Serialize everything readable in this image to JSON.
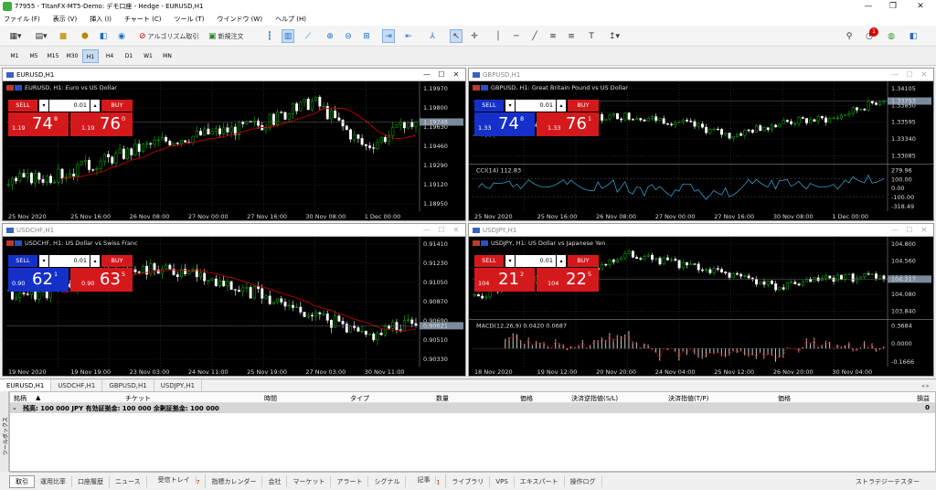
{
  "window": {
    "title": "77955 - TitanFX-MT5-Demo: デモ口座 - Hedge - EURUSD,H1",
    "min": "—",
    "max": "❐",
    "close": "✕"
  },
  "menu": [
    "ファイル (F)",
    "表示 (V)",
    "挿入 (I)",
    "チャート (C)",
    "ツール (T)",
    "ウインドウ (W)",
    "ヘルプ (H)"
  ],
  "toolbar": {
    "algo_label": "アルゴリズム取引",
    "neworder_label": "新規注文",
    "notify_badge": "1"
  },
  "timeframes": [
    "M1",
    "M5",
    "M15",
    "M30",
    "H1",
    "H4",
    "D1",
    "W1",
    "MN"
  ],
  "timeframe_active": "H1",
  "colors": {
    "bull": "#00c000",
    "bear": "#ffffff",
    "ma": "#c00000",
    "sell": "#d4191c",
    "sell_blue": "#1530c8",
    "buy": "#d4191c",
    "grid": "#3a3a3a",
    "bg": "#000000"
  },
  "charts": [
    {
      "id": "EURUSD",
      "tab_title": "EURUSD,H1",
      "caption": "EURUSD, H1:  Euro vs US Dollar",
      "active": true,
      "sell_label": "SELL",
      "buy_label": "BUY",
      "lot": "0.01",
      "sell_prefix": "1.19",
      "sell_big": "74",
      "sell_sup": "8",
      "buy_prefix": "1.19",
      "buy_big": "76",
      "buy_sup": "0",
      "sell_blue": false,
      "price_labels": [
        "1.19970",
        "1.19800",
        "1.19630",
        "1.19460",
        "1.19290",
        "1.19120",
        "1.18950"
      ],
      "current_price": "1.19748",
      "time_labels": [
        "25 Nov 2020",
        "25 Nov 16:00",
        "26 Nov 08:00",
        "27 Nov 00:00",
        "27 Nov 16:00",
        "30 Nov 08:00",
        "1 Dec 00:00"
      ],
      "seed": 3,
      "trend": [
        0.2,
        0.25,
        0.4,
        0.55,
        0.62,
        0.7,
        0.9,
        0.5,
        0.72
      ],
      "indicator": null
    },
    {
      "id": "GBPUSD",
      "tab_title": "GBPUSD,H1",
      "caption": "GBPUSD, H1:  Great Britain Pound vs US Dollar",
      "active": false,
      "sell_label": "SELL",
      "buy_label": "BUY",
      "lot": "0.01",
      "sell_prefix": "1.33",
      "sell_big": "74",
      "sell_sup": "8",
      "buy_prefix": "1.33",
      "buy_big": "76",
      "buy_sup": "1",
      "sell_blue": true,
      "price_labels": [
        "1.34105",
        "1.33850",
        "1.33595",
        "1.33340",
        "1.33085"
      ],
      "current_price": "1.33753",
      "time_labels": [
        "25 Nov 2020",
        "25 Nov 16:00",
        "26 Nov 08:00",
        "27 Nov 00:00",
        "27 Nov 16:00",
        "30 Nov 08:00",
        "1 Dec 00:00"
      ],
      "seed": 7,
      "trend": [
        0.3,
        0.45,
        0.55,
        0.6,
        0.5,
        0.3,
        0.5,
        0.55,
        0.85
      ],
      "indicator": {
        "type": "cci",
        "caption": "CCI(14) 112.83",
        "labels": [
          "279.96",
          "100.00",
          "0.00",
          "-100.00",
          "-318.49"
        ]
      }
    },
    {
      "id": "USDCHF",
      "tab_title": "USDCHF,H1",
      "caption": "USDCHF, H1:  US Dollar vs Swiss Franc",
      "active": false,
      "sell_label": "SELL",
      "buy_label": "BUY",
      "lot": "0.01",
      "sell_prefix": "0.90",
      "sell_big": "62",
      "sell_sup": "1",
      "buy_prefix": "0.90",
      "buy_big": "63",
      "buy_sup": "5",
      "sell_blue": true,
      "price_labels": [
        "0.91410",
        "0.91230",
        "0.91050",
        "0.90870",
        "0.90690",
        "0.90510",
        "0.90330"
      ],
      "current_price": "0.90621",
      "time_labels": [
        "19 Nov 2020",
        "19 Nov 19:00",
        "23 Nov 03:00",
        "24 Nov 11:00",
        "25 Nov 19:00",
        "27 Nov 03:00",
        "30 Nov 11:00"
      ],
      "seed": 11,
      "trend": [
        0.55,
        0.6,
        0.75,
        0.8,
        0.7,
        0.55,
        0.4,
        0.2,
        0.35
      ],
      "indicator": null
    },
    {
      "id": "USDJPY",
      "tab_title": "USDJPY,H1",
      "caption": "USDJPY, H1:  US Dollar vs Japanese Yen",
      "active": false,
      "sell_label": "SELL",
      "buy_label": "BUY",
      "lot": "0.01",
      "sell_prefix": "104",
      "sell_big": "21",
      "sell_sup": "2",
      "buy_prefix": "104",
      "buy_big": "22",
      "buy_sup": "5",
      "sell_blue": false,
      "price_labels": [
        "104.800",
        "104.560",
        "104.320",
        "104.080",
        "103.840"
      ],
      "current_price": "104.217",
      "time_labels": [
        "18 Nov 2020",
        "19 Nov 12:00",
        "20 Nov 20:00",
        "24 Nov 04:00",
        "25 Nov 12:00",
        "26 Nov 20:00",
        "30 Nov 04:00"
      ],
      "seed": 5,
      "trend": [
        0.2,
        0.45,
        0.55,
        0.85,
        0.7,
        0.55,
        0.35,
        0.5,
        0.5
      ],
      "indicator": {
        "type": "macd",
        "caption": "MACD(12,26,9) 0.0420 0.0687",
        "labels": [
          "0.3684",
          "0.0000",
          "-0.1666"
        ]
      }
    }
  ],
  "bottom_tabs": [
    "EURUSD,H1",
    "USDCHF,H1",
    "GBPUSD,H1",
    "USDJPY,H1"
  ],
  "bottom_tab_active": "EURUSD,H1",
  "terminal": {
    "side_label": "ツールボックス",
    "columns": [
      "銘柄",
      "チケット",
      "時間",
      "タイプ",
      "数量",
      "価格",
      "決済逆指値(S/L)",
      "決済指値(T/P)",
      "価格",
      "損益"
    ],
    "sort_glyph": "▲",
    "balance_line": "残高: 100 000 JPY  有効証拠金: 100 000  余剰証拠金: 100 000",
    "balance_value": "0",
    "tabs": [
      "取引",
      "運用比率",
      "口座履歴",
      "ニュース",
      "受信トレイ",
      "指標カレンダー",
      "会社",
      "マーケット",
      "アラート",
      "シグナル",
      "記事",
      "ライブラリ",
      "VPS",
      "エキスパート",
      "操作ログ"
    ],
    "tab_active": "取引",
    "inbox_badge": "7",
    "article_badge": "1",
    "strategy_tester": "ストラテジーテスター"
  }
}
